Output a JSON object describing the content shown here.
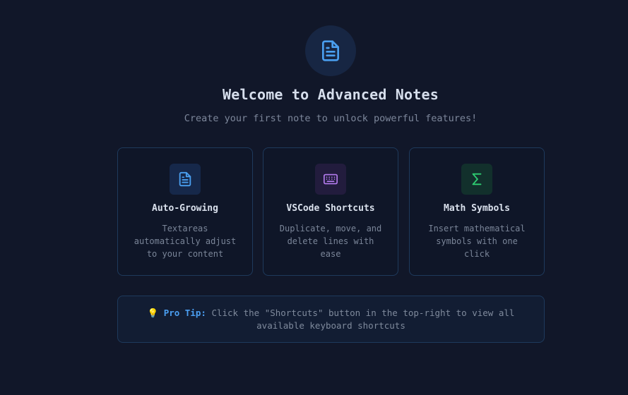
{
  "hero": {
    "icon": "document-icon",
    "title": "Welcome to Advanced Notes",
    "subtitle": "Create your first note to unlock powerful features!"
  },
  "features": [
    {
      "icon": "document-icon",
      "title": "Auto-Growing",
      "description": "Textareas automatically adjust to your content",
      "accent": "#4a9ff0",
      "icon_bg": "#16284a"
    },
    {
      "icon": "keyboard-icon",
      "title": "VSCode Shortcuts",
      "description": "Duplicate, move, and delete lines with ease",
      "accent": "#b57cf0",
      "icon_bg": "#221c3d"
    },
    {
      "icon": "sigma-icon",
      "title": "Math Symbols",
      "description": "Insert mathematical symbols with one click",
      "accent": "#2ecc71",
      "icon_bg": "#12302c"
    }
  ],
  "tip": {
    "emoji": "💡",
    "label": "Pro Tip:",
    "text": "Click the \"Shortcuts\" button in the top-right to view all available keyboard shortcuts"
  }
}
